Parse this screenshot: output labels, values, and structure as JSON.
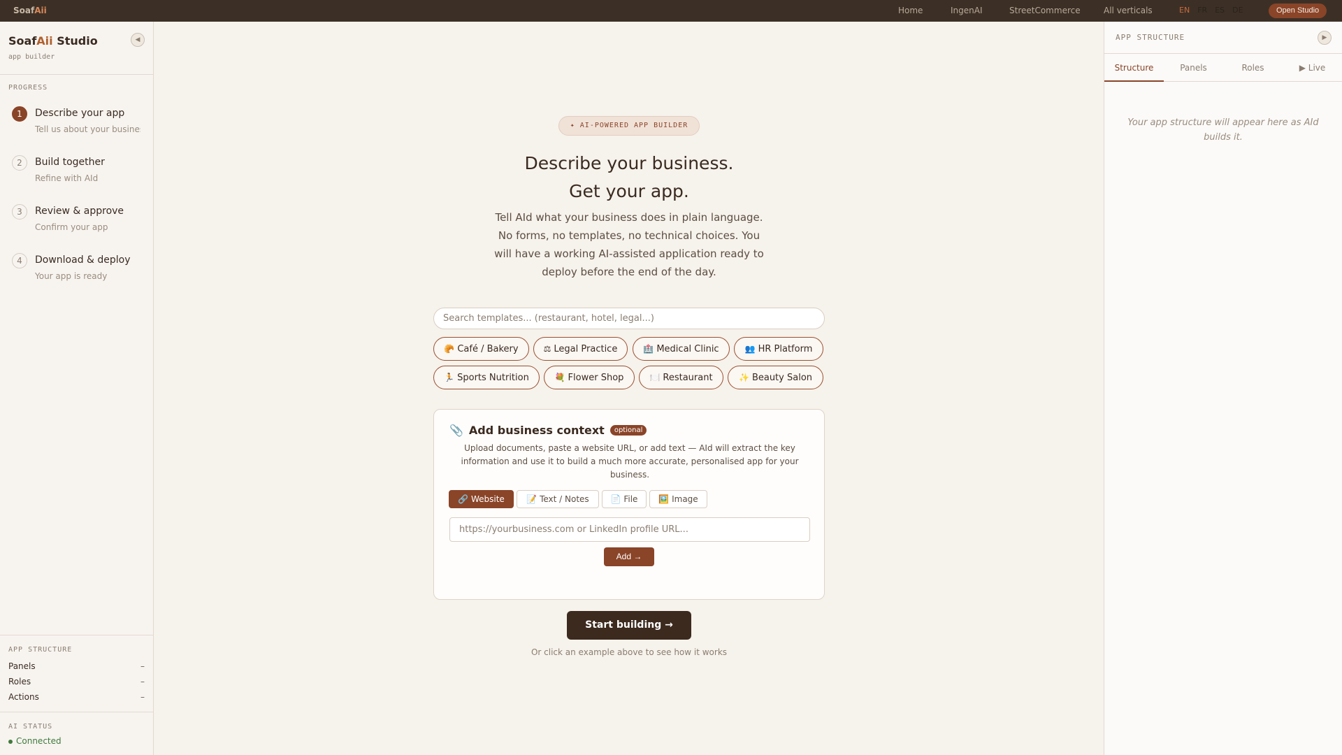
{
  "topbar": {
    "brand_prefix": "Soaf",
    "brand_accent": "Aii",
    "nav": [
      "Home",
      "IngenAI",
      "StreetCommerce",
      "All verticals"
    ],
    "langs": [
      "EN",
      "FR",
      "ES",
      "DE"
    ],
    "active_lang": "EN",
    "open_studio": "Open Studio"
  },
  "sidebar": {
    "title_prefix": "Soaf",
    "title_accent": "Aii",
    "title_suffix": " Studio",
    "subtitle": "app builder",
    "collapse_icon": "◀",
    "progress_label": "PROGRESS",
    "steps": [
      {
        "num": "1",
        "title": "Describe your app",
        "sub": "Tell us about your business",
        "active": true
      },
      {
        "num": "2",
        "title": "Build together",
        "sub": "Refine with AId",
        "active": false
      },
      {
        "num": "3",
        "title": "Review & approve",
        "sub": "Confirm your app",
        "active": false
      },
      {
        "num": "4",
        "title": "Download & deploy",
        "sub": "Your app is ready",
        "active": false
      }
    ],
    "structure_label": "APP STRUCTURE",
    "structure": [
      {
        "label": "Panels",
        "value": "–"
      },
      {
        "label": "Roles",
        "value": "–"
      },
      {
        "label": "Actions",
        "value": "–"
      }
    ],
    "ai_label": "AI STATUS",
    "ai_status": "Connected"
  },
  "right_panel": {
    "title": "APP STRUCTURE",
    "toggle_icon": "▶",
    "tabs": [
      "Structure",
      "Panels",
      "Roles",
      "▶ Live"
    ],
    "active_tab": "Structure",
    "empty_text": "Your app structure will appear here as AId builds it."
  },
  "main": {
    "badge": "✦ AI-POWERED APP BUILDER",
    "title_line1": "Describe your business.",
    "title_line2": "Get your app.",
    "description": "Tell AId what your business does in plain language. No forms, no templates, no technical choices. You will have a working AI-assisted application ready to deploy before the end of the day.",
    "search_placeholder": "Search templates... (restaurant, hotel, legal...)",
    "chips": [
      {
        "icon": "🥐",
        "label": "Café / Bakery"
      },
      {
        "icon": "⚖",
        "label": "Legal Practice"
      },
      {
        "icon": "🏥",
        "label": "Medical Clinic"
      },
      {
        "icon": "👥",
        "label": "HR Platform"
      },
      {
        "icon": "🏃",
        "label": "Sports Nutrition"
      },
      {
        "icon": "💐",
        "label": "Flower Shop"
      },
      {
        "icon": "🍽️",
        "label": "Restaurant"
      },
      {
        "icon": "✨",
        "label": "Beauty Salon"
      }
    ],
    "context": {
      "icon": "📎",
      "title": "Add business context",
      "optional": "optional",
      "description": "Upload documents, paste a website URL, or add text — AId will extract the key information and use it to build a much more accurate, personalised app for your business.",
      "tabs": [
        {
          "icon": "🔗",
          "label": "Website"
        },
        {
          "icon": "📝",
          "label": "Text / Notes"
        },
        {
          "icon": "📄",
          "label": "File"
        },
        {
          "icon": "🖼️",
          "label": "Image"
        }
      ],
      "active_tab": "Website",
      "input_placeholder": "https://yourbusiness.com or LinkedIn profile URL...",
      "add_button": "Add →"
    },
    "start_button": "Start building →",
    "hint": "Or click an example above to see how it works"
  }
}
